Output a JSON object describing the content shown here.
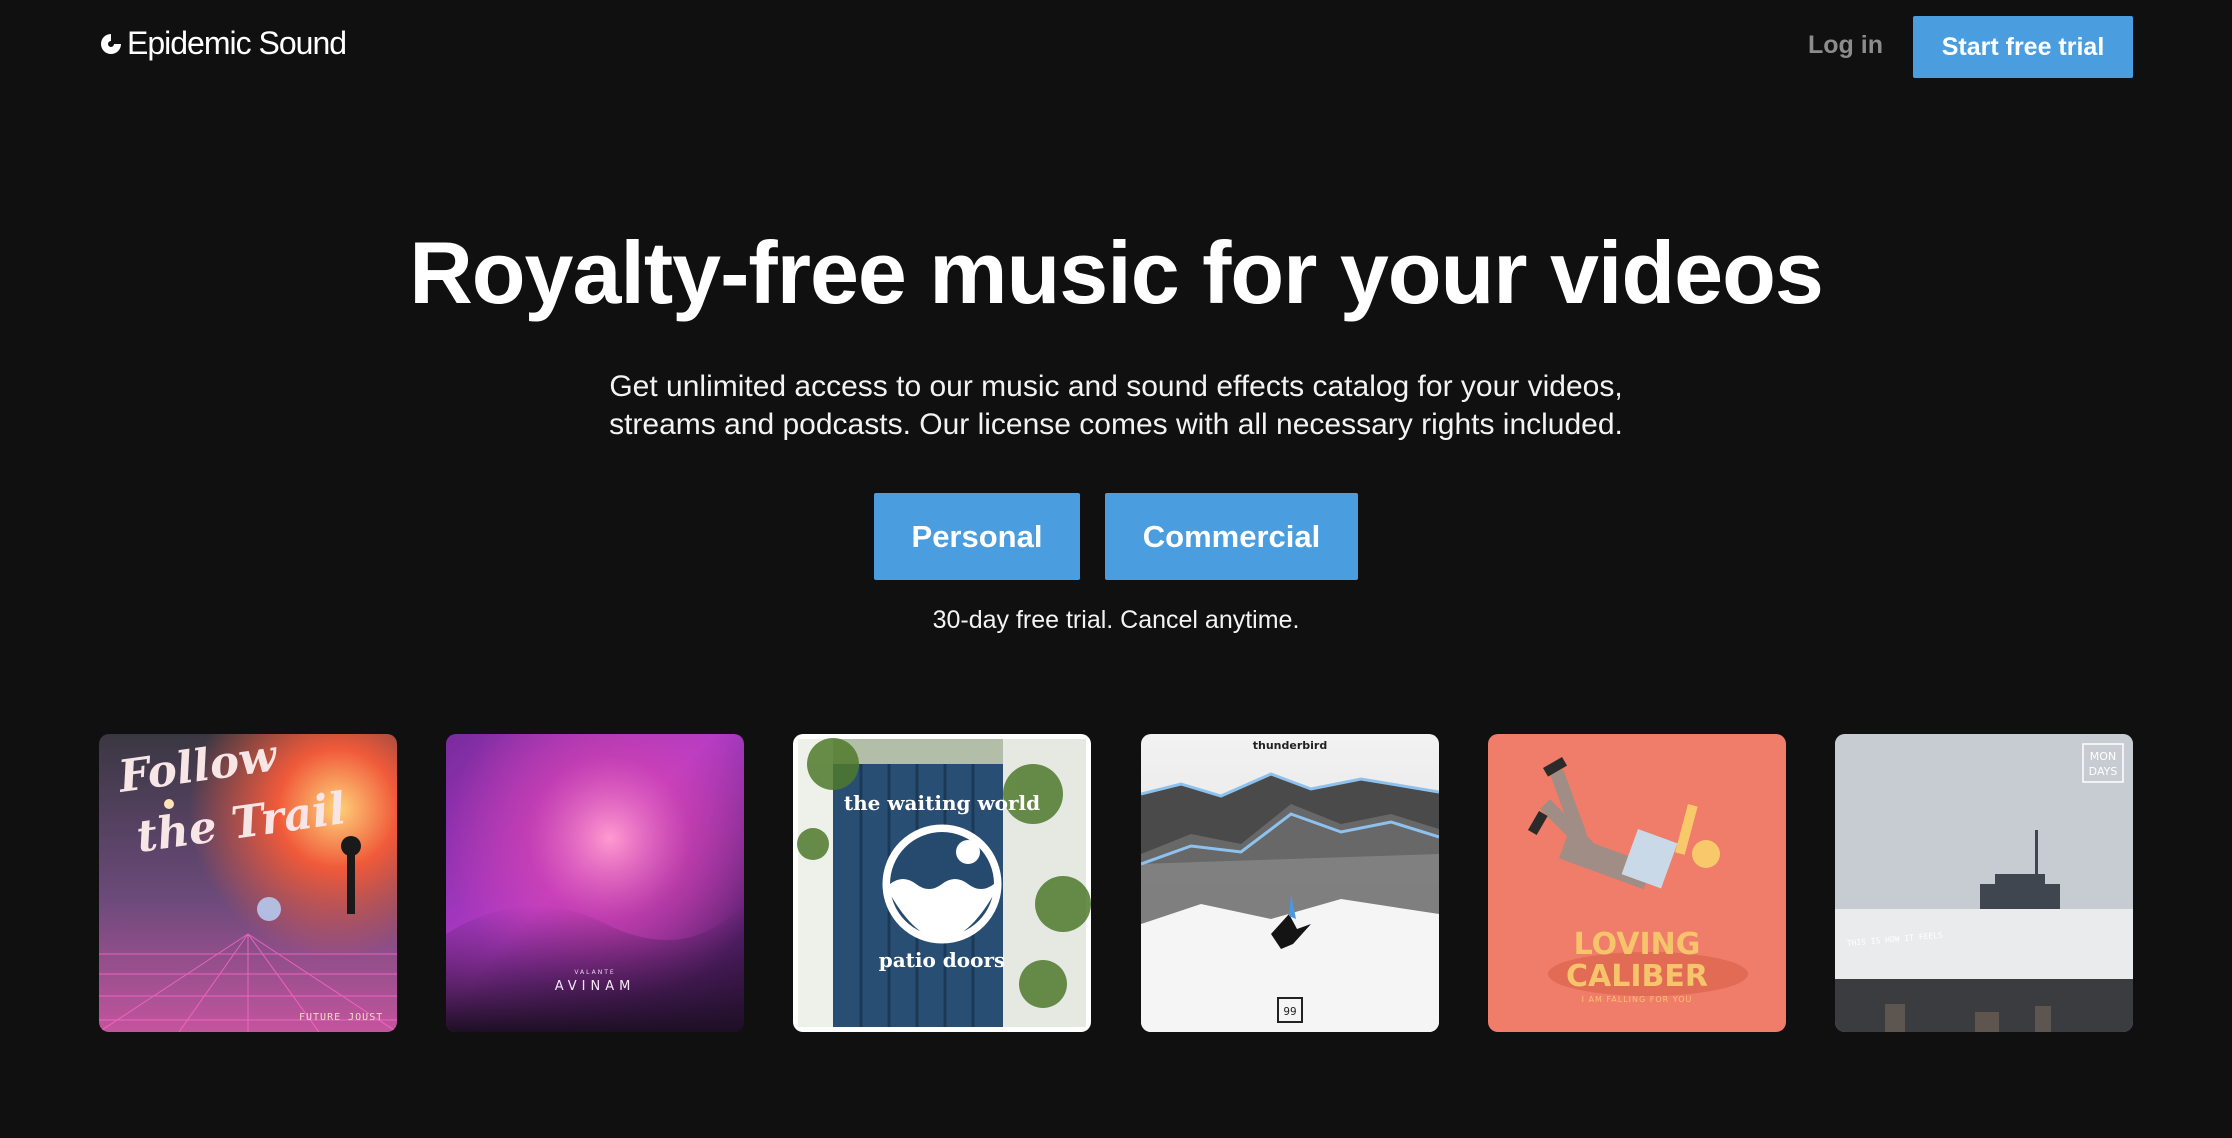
{
  "header": {
    "brand": "Epidemic Sound",
    "login_label": "Log in",
    "trial_label": "Start free trial"
  },
  "hero": {
    "title": "Royalty-free music for your videos",
    "subtitle_line1": "Get unlimited access to our music and sound effects catalog for your videos,",
    "subtitle_line2": "streams and podcasts. Our license comes with all necessary rights included.",
    "personal_label": "Personal",
    "commercial_label": "Commercial",
    "note": "30-day free trial. Cancel anytime."
  },
  "albums": [
    {
      "title_line1": "Follow",
      "title_line2": "the Trail",
      "artist": "FUTURE JOUST"
    },
    {
      "artist_small": "VALANTE",
      "title": "AVINAM"
    },
    {
      "title": "the waiting world",
      "subtitle": "patio doors"
    },
    {
      "artist": "thunderbird"
    },
    {
      "title_line1": "LOVING",
      "title_line2": "CALIBER",
      "subtitle": "I AM FALLING FOR YOU"
    },
    {
      "badge_line1": "MON",
      "badge_line2": "DAYS",
      "subtitle": "THIS IS HOW IT FEELS"
    }
  ],
  "colors": {
    "background": "#101010",
    "accent": "#4a9ee0",
    "muted": "#8c8c8c"
  }
}
